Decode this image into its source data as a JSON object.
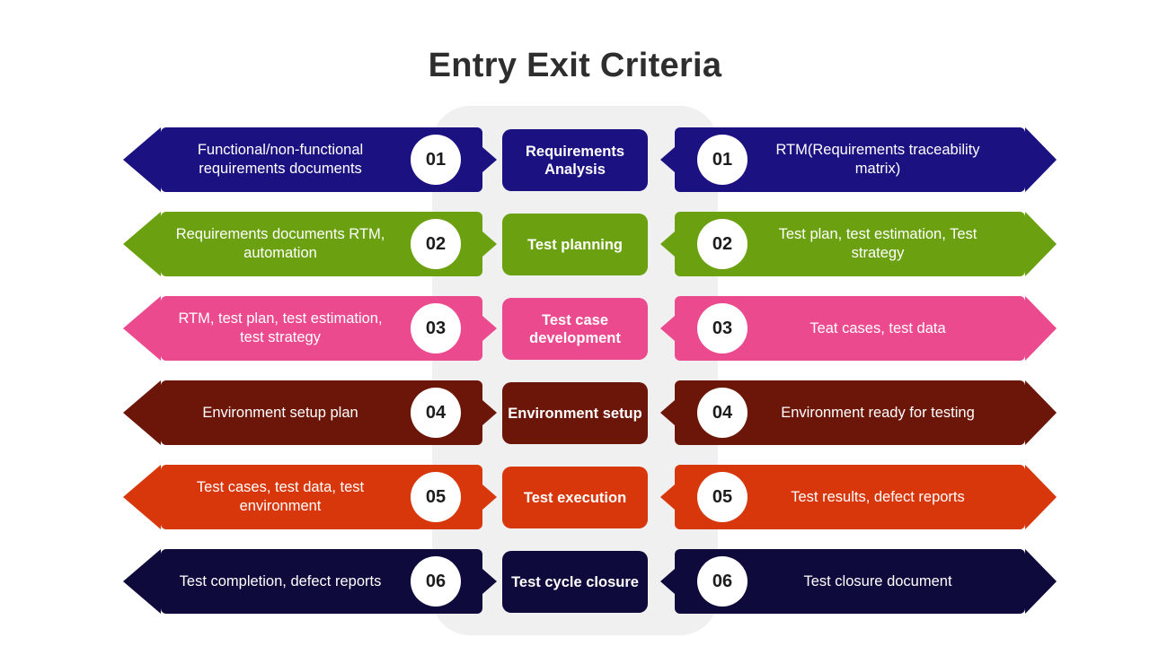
{
  "title": "Entry Exit Criteria",
  "colors": {
    "background": "#ffffff",
    "panel": "#f0f0f0",
    "title_text": "#2e2e2e",
    "row1": "#1c1181",
    "row2": "#6ba110",
    "row3": "#ec4a8e",
    "row4": "#6b1608",
    "row5": "#d8370c",
    "row6": "#0f0a3c"
  },
  "rows": [
    {
      "number": "01",
      "color_key": "row1",
      "entry": "Functional/non-functional requirements documents",
      "phase": "Requirements Analysis",
      "exit": "RTM(Requirements traceability matrix)"
    },
    {
      "number": "02",
      "color_key": "row2",
      "entry": "Requirements documents RTM, automation",
      "phase": "Test planning",
      "exit": "Test plan, test estimation, Test strategy"
    },
    {
      "number": "03",
      "color_key": "row3",
      "entry": "RTM, test plan, test estimation, test strategy",
      "phase": "Test case development",
      "exit": "Teat cases, test data"
    },
    {
      "number": "04",
      "color_key": "row4",
      "entry": "Environment setup plan",
      "phase": "Environment setup",
      "exit": "Environment ready for testing"
    },
    {
      "number": "05",
      "color_key": "row5",
      "entry": "Test cases, test data, test environment",
      "phase": "Test execution",
      "exit": "Test results, defect reports"
    },
    {
      "number": "06",
      "color_key": "row6",
      "entry": "Test completion, defect reports",
      "phase": "Test cycle closure",
      "exit": "Test closure document"
    }
  ]
}
